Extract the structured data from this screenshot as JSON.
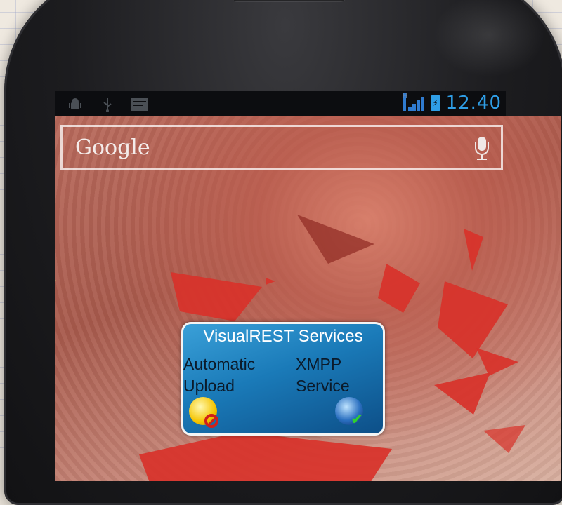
{
  "status_bar": {
    "time": "12.40",
    "network": "H",
    "left_icons": [
      "android-debug-icon",
      "usb-icon",
      "notification-icon"
    ]
  },
  "search_widget": {
    "brand": "Google",
    "mic_icon": "microphone-icon"
  },
  "app_widget": {
    "title": "VisualREST Services",
    "items": [
      {
        "label_line1": "Automatic",
        "label_line2": "Upload",
        "icon": "bulb-icon",
        "status_icon": "disabled-icon"
      },
      {
        "label_line1": "XMPP",
        "label_line2": "Service",
        "icon": "globe-icon",
        "status_icon": "check-icon"
      }
    ]
  },
  "colors": {
    "accent": "#2f9ee6",
    "widget_bg": "#1a7ab8",
    "wallpaper_shard": "#d8322a"
  }
}
